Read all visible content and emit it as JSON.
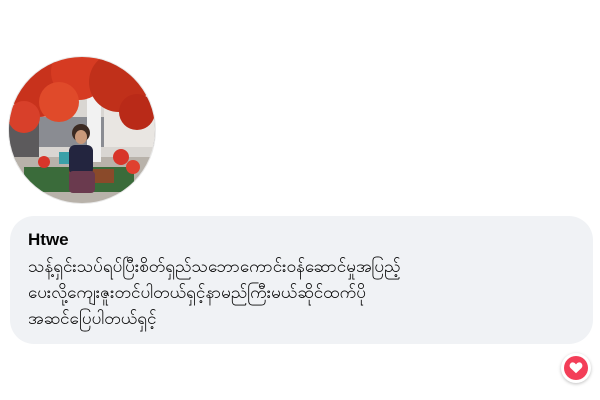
{
  "comment": {
    "author": "Htwe",
    "text": "သန့်ရှင်းသပ်ရပ်ပြီးစိတ်ရှည်သဘောကောင်းဝန်ဆောင်မှုအပြည့်\nပေးလို့ကျေးဇူးတင်ပါတယ်ရှင့်နာမည်ကြီးမယ်ဆိုင်ထက်ပို\nအဆင်ပြေပါတယ်ရှင့်"
  },
  "reaction": {
    "icon": "heart-icon",
    "color": "#f33e58"
  },
  "colors": {
    "bubble": "#f0f2f5",
    "text": "#050505"
  }
}
